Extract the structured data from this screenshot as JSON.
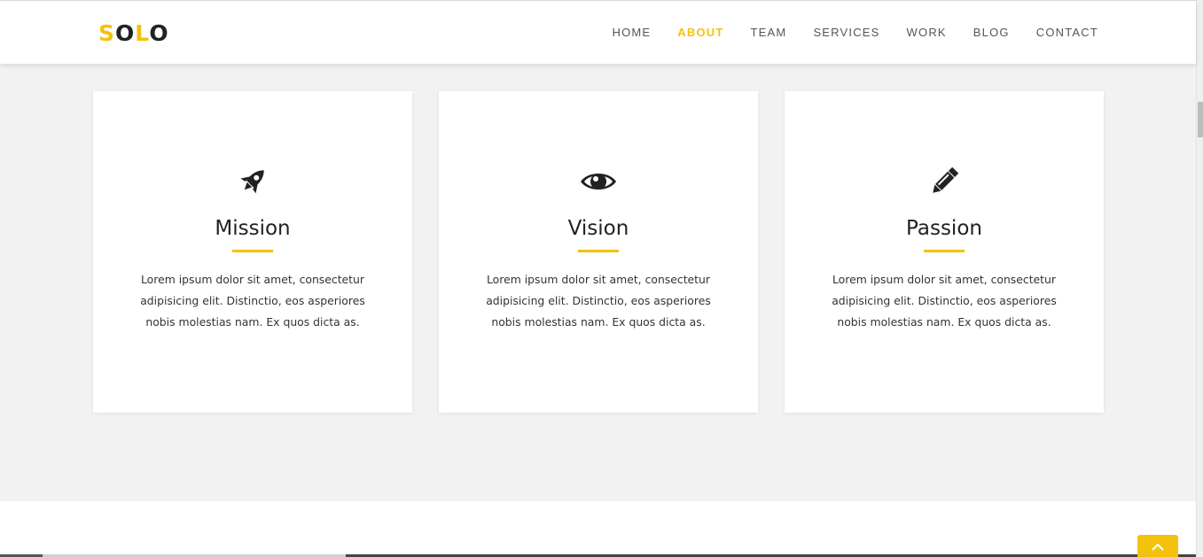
{
  "header": {
    "logo": {
      "first_letter": "S",
      "letter_o1": "O",
      "letter_l": "L",
      "letter_o2": "O"
    },
    "nav": [
      {
        "label": "HOME"
      },
      {
        "label": "ABOUT",
        "active": true
      },
      {
        "label": "TEAM"
      },
      {
        "label": "SERVICES"
      },
      {
        "label": "WORK"
      },
      {
        "label": "BLOG"
      },
      {
        "label": "CONTACT"
      }
    ]
  },
  "cards": [
    {
      "icon": "rocket-icon",
      "title": "Mission",
      "text": "Lorem ipsum dolor sit amet, consectetur adipisicing elit. Distinctio, eos asperiores nobis molestias nam. Ex quos dicta as."
    },
    {
      "icon": "eye-icon",
      "title": "Vision",
      "text": "Lorem ipsum dolor sit amet, consectetur adipisicing elit. Distinctio, eos asperiores nobis molestias nam. Ex quos dicta as."
    },
    {
      "icon": "pencil-icon",
      "title": "Passion",
      "text": "Lorem ipsum dolor sit amet, consectetur adipisicing elit. Distinctio, eos asperiores nobis molestias nam. Ex quos dicta as."
    }
  ],
  "back_to_top": {
    "icon": "chevron-up-icon"
  },
  "colors": {
    "accent": "#f4c20d",
    "section_bg": "#f2f2f2",
    "text_dark": "#222222"
  }
}
